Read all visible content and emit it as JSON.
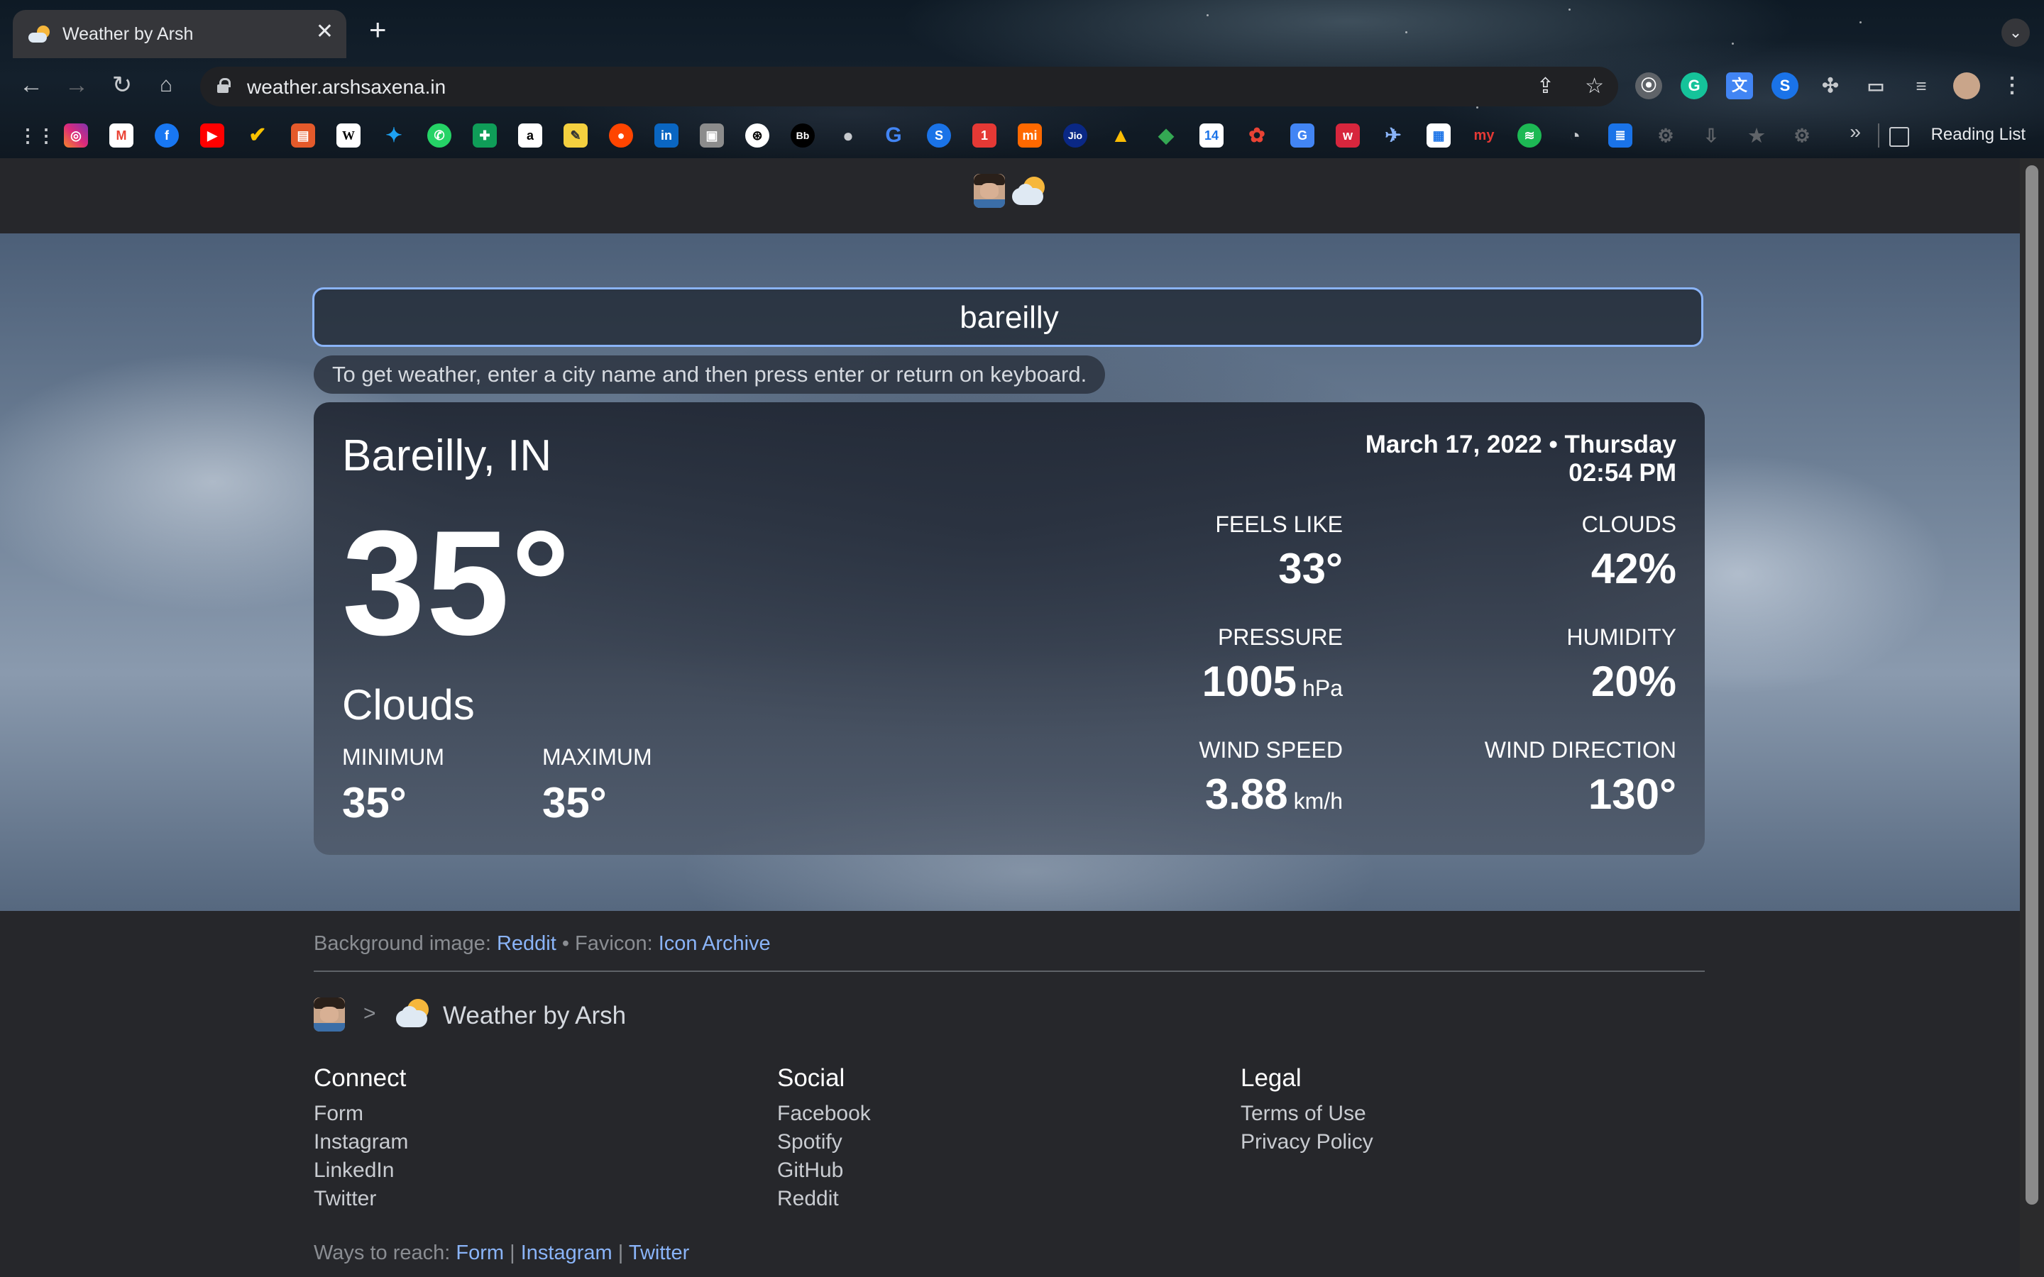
{
  "browser": {
    "tab_title": "Weather by Arsh",
    "url": "weather.arshsaxena.in",
    "reading_list_label": "Reading List",
    "icons": [
      "back-icon",
      "forward-icon",
      "reload-icon",
      "home-icon",
      "lock-icon",
      "share-icon",
      "star-icon",
      "extensions-icon",
      "cast-icon",
      "tab-search-icon"
    ]
  },
  "search": {
    "value": "bareilly",
    "hint": "To get weather, enter a city name and then press enter or return on keyboard."
  },
  "weather": {
    "city": "Bareilly, IN",
    "temperature": "35°",
    "condition": "Clouds",
    "minimum_label": "MINIMUM",
    "minimum_value": "35°",
    "maximum_label": "MAXIMUM",
    "maximum_value": "35°",
    "date_line": "March 17, 2022 • Thursday",
    "time": "02:54 PM",
    "feels_like_label": "FEELS LIKE",
    "feels_like_value": "33°",
    "clouds_label": "CLOUDS",
    "clouds_value": "42%",
    "pressure_label": "PRESSURE",
    "pressure_value": "1005",
    "pressure_unit": "hPa",
    "humidity_label": "HUMIDITY",
    "humidity_value": "20%",
    "wind_speed_label": "WIND SPEED",
    "wind_speed_value": "3.88",
    "wind_speed_unit": "km/h",
    "wind_direction_label": "WIND DIRECTION",
    "wind_direction_value": "130°"
  },
  "footer": {
    "bg_label": "Background image:",
    "bg_link": "Reddit",
    "separator": "•",
    "favicon_label": "Favicon:",
    "favicon_link": "Icon Archive",
    "breadcrumb_arrow": ">",
    "breadcrumb_title": "Weather by Arsh",
    "columns": [
      {
        "title": "Connect",
        "items": [
          "Form",
          "Instagram",
          "LinkedIn",
          "Twitter"
        ]
      },
      {
        "title": "Social",
        "items": [
          "Facebook",
          "Spotify",
          "GitHub",
          "Reddit"
        ]
      },
      {
        "title": "Legal",
        "items": [
          "Terms of Use",
          "Privacy Policy"
        ]
      }
    ],
    "reach_label": "Ways to reach:",
    "reach_links": [
      "Form",
      "Instagram",
      "Twitter"
    ],
    "reach_separator": "|"
  },
  "colors": {
    "accent": "#8ab4f8",
    "header_bg": "#26272b",
    "card_text": "#ffffff"
  }
}
